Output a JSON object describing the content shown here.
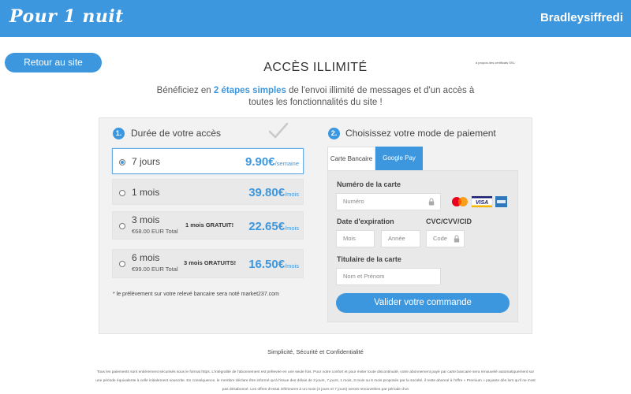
{
  "header": {
    "logo": "Pour 1 nuit",
    "username": "Bradleysiffredi",
    "bar_color": "#3d97de"
  },
  "back_button": {
    "label": "Retour au site"
  },
  "ssl_link": "à propos des certificats SSL",
  "title": "ACCÈS ILLIMITÉ",
  "subtitle": {
    "pre": "Bénéficiez en ",
    "highlight": "2 étapes simples",
    "post": " de l'envoi illimité de messages et d'un accès à toutes les fonctionnalités du site !"
  },
  "step1": {
    "number": "1.",
    "title": "Durée de votre accès",
    "plans": [
      {
        "name": "7 jours",
        "price": "9.90€",
        "period": "/semaine",
        "selected": true
      },
      {
        "name": "1 mois",
        "price": "39.80€",
        "period": "/mois",
        "selected": false
      },
      {
        "name": "3 mois",
        "total": "€68.00 EUR Total",
        "promo": "1 mois GRATUIT!",
        "price": "22.65€",
        "period": "/mois",
        "selected": false
      },
      {
        "name": "6 mois",
        "total": "€99.00 EUR Total",
        "promo": "3 mois GRATUITS!",
        "price": "16.50€",
        "period": "/mois",
        "selected": false
      }
    ],
    "footnote": "* le prélèvement sur votre relevé bancaire sera noté market237.com"
  },
  "step2": {
    "number": "2.",
    "title": "Choisissez votre mode de paiement",
    "tabs": [
      {
        "label": "Carte Bancaire",
        "active": false
      },
      {
        "label": "Google Pay",
        "active": true
      }
    ],
    "card_number": {
      "label": "Numéro de la carte",
      "placeholder": "Numéro"
    },
    "expiry": {
      "label": "Date d'expiration",
      "month_placeholder": "Mois",
      "year_placeholder": "Année"
    },
    "cvc": {
      "label": "CVC/CVV/CID",
      "placeholder": "Code"
    },
    "holder": {
      "label": "Titulaire de la carte",
      "placeholder": "Nom et Prénom"
    },
    "card_logos": {
      "visa_text": "VISA"
    },
    "submit_label": "Valider votre commande"
  },
  "tagline": "Simplicité, Sécurité et Confidentialité",
  "legal": "Tous les paiements sont entièrement sécurisés sous le format https. L'intégralité de l'abonnement est prélevée en une seule fois. Pour votre confort et pour éviter toute discontinuité, votre abonnement payé par carte bancaire sera renouvelé automatiquement sur une période équivalente à celle initialement souscrite. En conséquence, le membre déclare être informé qu'à l'issue des délais de 3 jours, 7 jours, 1 mois, 3 mois ou 6 mois proposés par la société, il reste abonné à l'offre « Premium » payante dès lors qu'il ne s'est pas désabonné. Les offres d'essai inférieures à un mois (3 jours et 7 jours) seront renouvelées par période d'un"
}
